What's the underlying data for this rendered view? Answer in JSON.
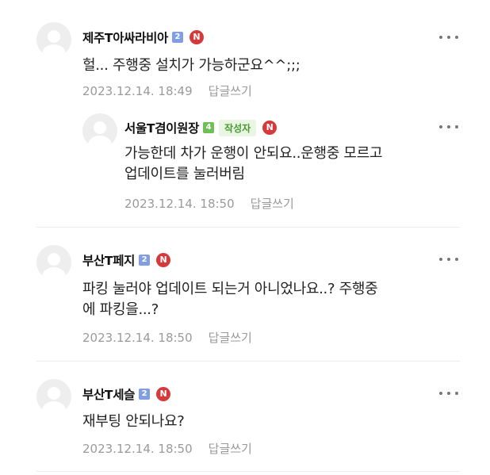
{
  "comments": [
    {
      "nickname": "제주T아싸라비아",
      "level": "2",
      "badge": "N",
      "text": "헐... 주행중 설치가 가능하군요^^;;;",
      "date": "2023.12.14. 18:49",
      "reply_label": "답글쓰기"
    },
    {
      "nickname": "서울T겸이원장",
      "level": "4",
      "author_tag": "작성자",
      "badge": "N",
      "text_line1": "가능한데 차가 운행이 안되요..운행중 모르고",
      "text_line2": "업데이트를 눌러버림",
      "date": "2023.12.14. 18:50",
      "reply_label": "답글쓰기"
    },
    {
      "nickname": "부산T페지",
      "level": "2",
      "badge": "N",
      "text_line1": "파킹 눌러야 업데이트 되는거 아니었나요..? 주행중",
      "text_line2": "에 파킹을...?",
      "date": "2023.12.14. 18:50",
      "reply_label": "답글쓰기"
    },
    {
      "nickname": "부산T세슬",
      "level": "2",
      "badge": "N",
      "text": "재부팅 안되나요?",
      "date": "2023.12.14. 18:50",
      "reply_label": "답글쓰기"
    }
  ],
  "colors": {
    "author_tag": "#4a9a34",
    "new_badge": "#d6393b",
    "level_blue": "#7f9ee3",
    "level_green": "#6fbf56"
  },
  "icons": {
    "more": "more-dots-icon",
    "avatar": "default-avatar-icon"
  }
}
